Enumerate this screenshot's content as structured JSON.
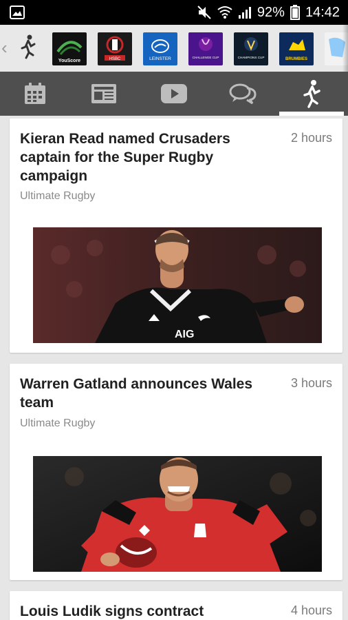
{
  "status_bar": {
    "battery": "92%",
    "time": "14:42"
  },
  "tabs": [
    {
      "name": "fixtures",
      "icon": "calendar-icon"
    },
    {
      "name": "news",
      "icon": "newspaper-icon"
    },
    {
      "name": "videos",
      "icon": "play-icon"
    },
    {
      "name": "chat",
      "icon": "chat-bubbles-icon"
    },
    {
      "name": "players",
      "icon": "runner-icon",
      "active": true
    }
  ],
  "team_strip": {
    "logos": [
      {
        "name": "youscore-logo",
        "text": "YouScore"
      },
      {
        "name": "hsbc-sevens-logo",
        "text": "HSBC"
      },
      {
        "name": "leinster-logo",
        "text": "LEINSTER"
      },
      {
        "name": "challenge-cup-logo",
        "text": "CHALLENGE CUP"
      },
      {
        "name": "champions-cup-logo",
        "text": "CHAMPIONS CUP"
      },
      {
        "name": "brumbies-logo",
        "text": "BRUMBIES"
      },
      {
        "name": "partial-logo",
        "text": ""
      }
    ]
  },
  "articles": [
    {
      "title": "Kieran Read named Crusaders captain for the Super Rugby campaign",
      "time": "2 hours",
      "source": "Ultimate Rugby",
      "image": "rugby-player-black-jersey-photo"
    },
    {
      "title": "Warren Gatland announces Wales team",
      "time": "3 hours",
      "source": "Ultimate Rugby",
      "image": "rugby-player-red-jersey-photo"
    },
    {
      "title": "Louis Ludik signs contract",
      "time": "4 hours",
      "source": "",
      "image": ""
    }
  ],
  "colors": {
    "tab_bar": "#4f4f4f",
    "background": "#e6e6e6",
    "card": "#ffffff"
  }
}
